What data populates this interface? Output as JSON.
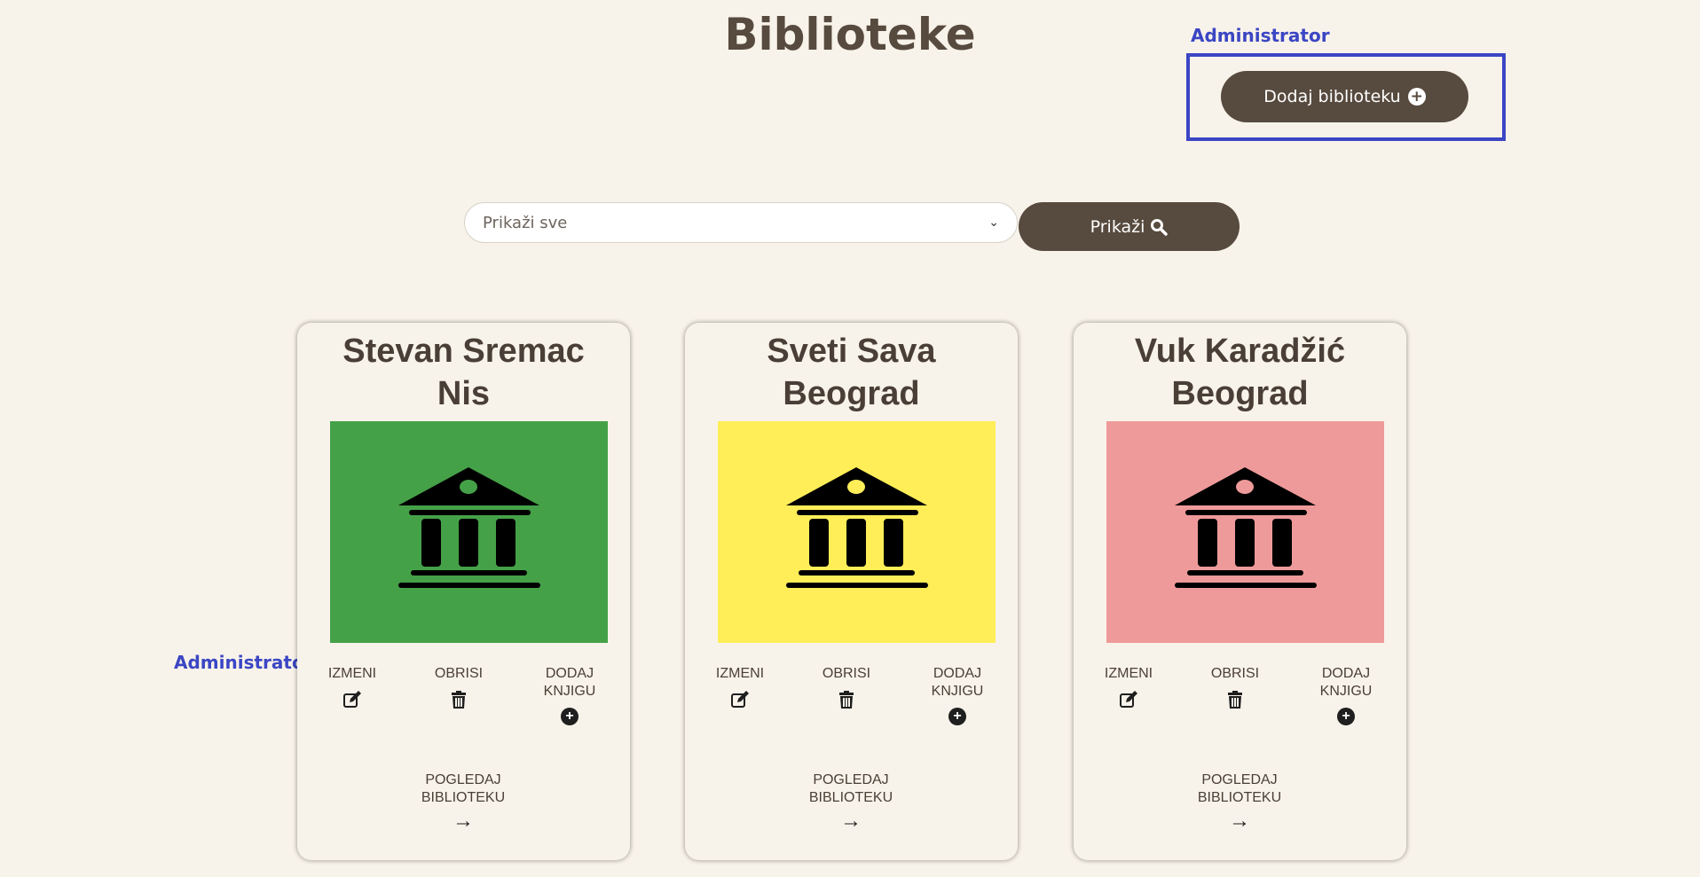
{
  "header": {
    "title": "Biblioteke",
    "admin_label": "Administrator",
    "add_library_label": "Dodaj biblioteku"
  },
  "filter": {
    "selected": "Prikaži sve",
    "show_label": "Prikaži"
  },
  "admin_side_label": "Administrator",
  "actions": {
    "edit": "IZMENI",
    "delete": "OBRISI",
    "add_book_line1": "DODAJ",
    "add_book_line2": "KNJIGU",
    "view_line1": "POGLEDAJ",
    "view_line2": "BIBLIOTEKU"
  },
  "libraries": [
    {
      "name": "Stevan Sremac",
      "city": "Nis",
      "color": "#45a148"
    },
    {
      "name": "Sveti Sava",
      "city": "Beograd",
      "color": "#ffee58"
    },
    {
      "name": "Vuk Karadžić",
      "city": "Beograd",
      "color": "#ef9a9a"
    }
  ],
  "colors": {
    "background": "#f8f3ea",
    "primary_button": "#574a3e",
    "admin_annotation": "#3b46c4"
  },
  "icons": {
    "library": "library-building-icon",
    "edit": "edit-icon",
    "delete": "trash-icon",
    "add": "plus-circle-icon",
    "view": "arrow-right-icon",
    "search": "search-icon"
  }
}
